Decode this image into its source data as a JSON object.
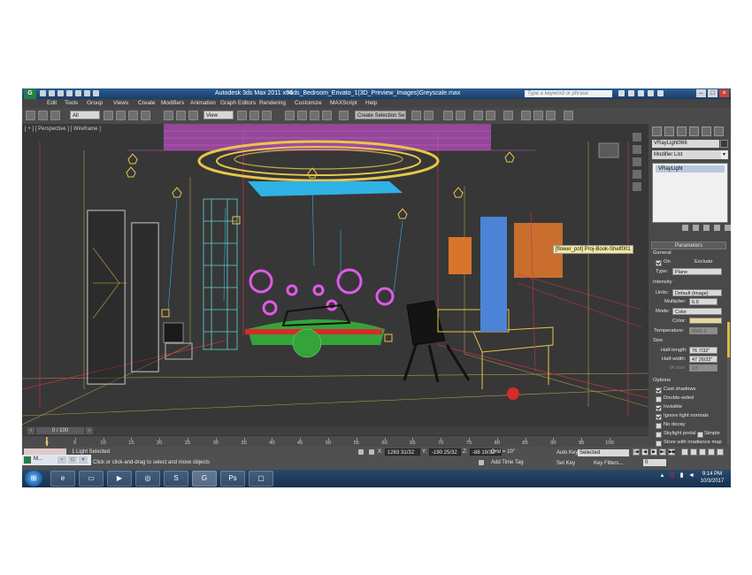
{
  "window": {
    "app_title": "Autodesk 3ds Max  2011 x64",
    "file_title": "Kids_Bedroom_Envato_1(3D_Preview_Images)Greyscale.max",
    "search_placeholder": "Type a keyword or phrase",
    "app_icon": "3ds-max-icon"
  },
  "menu": [
    "Edit",
    "Tools",
    "Group",
    "Views",
    "Create",
    "Modifiers",
    "Animation",
    "Graph Editors",
    "Rendering",
    "Customize",
    "MAXScript",
    "Help"
  ],
  "toolbar": {
    "filter_value": "All",
    "refcoord_value": "View",
    "selection_set_placeholder": "Create Selection Se"
  },
  "viewport": {
    "label": "[ + ] [ Perspective ] [ Wireframe ]",
    "tooltip": "[flower_pot] Proj-Book-Shelf001"
  },
  "command_panel": {
    "object_name": "VRayLight066",
    "modifier_list_label": "Modifier List",
    "stack_item": "VRayLight",
    "parameters_title": "Parameters",
    "general_label": "General",
    "on_label": "On",
    "on_checked": true,
    "exclude_label": "Exclude",
    "type_label": "Type:",
    "type_value": "Plane",
    "intensity_label": "Intensity",
    "units_label": "Units:",
    "units_value": "Default (image)",
    "multiplier_label": "Multiplier:",
    "multiplier_value": "6.0",
    "mode_label": "Mode:",
    "mode_value": "Color",
    "color_label": "Color:",
    "color_swatch": "#e8d79a",
    "temperature_label": "Temperature:",
    "temperature_value": "6500.0",
    "size_label": "Size",
    "half_length_label": "Half-length:",
    "half_length_value": "76 7/32\"",
    "half_width_label": "Half-width:",
    "half_width_value": "47 26/32\"",
    "w_size_label": "W size",
    "w_size_value": "10\"",
    "options_label": "Options",
    "options": [
      {
        "label": "Cast shadows",
        "checked": true
      },
      {
        "label": "Double-sided",
        "checked": false
      },
      {
        "label": "Invisible",
        "checked": true
      },
      {
        "label": "Ignore light normals",
        "checked": true
      },
      {
        "label": "No decay",
        "checked": false
      },
      {
        "label": "Skylight portal",
        "checked": false
      },
      {
        "label": "Store with irradiance map",
        "checked": false
      }
    ],
    "simple_label": "Simple"
  },
  "timeline": {
    "frame_display": "0 / 100",
    "ruler_ticks": [
      "0",
      "5",
      "10",
      "15",
      "20",
      "25",
      "30",
      "35",
      "40",
      "45",
      "50",
      "55",
      "60",
      "65",
      "70",
      "75",
      "80",
      "85",
      "90",
      "95",
      "100"
    ]
  },
  "status": {
    "selection_status": "1 Light Selected",
    "prompt": "Click or click-and-drag to select and move objects",
    "x_value": "1263 31/32",
    "y_value": "-190 25/32",
    "z_value": "-88 19/32\"",
    "grid_label": "Grid = 10\"",
    "add_time_tag": "Add Time Tag",
    "auto_key": "Auto Key",
    "set_key": "Set Key",
    "key_mode_value": "Selected",
    "key_filters": "Key Filters...",
    "current_frame": "0"
  },
  "mini_window": {
    "label": "M..."
  },
  "taskbar": {
    "time": "9:14 PM",
    "date": "10/3/2017"
  },
  "colors": {
    "ceiling_magenta": "#e05ae8",
    "ceiling_gold": "#e9c64a",
    "glass_cyan": "#2fb2e6",
    "bed_green": "#34a43a",
    "bed_red": "#d62b2b",
    "shelf_cyan": "#5fd6d6",
    "orange_box": "#d9742d",
    "blue_panel": "#4d83d6",
    "wire_red": "#c8324a"
  }
}
